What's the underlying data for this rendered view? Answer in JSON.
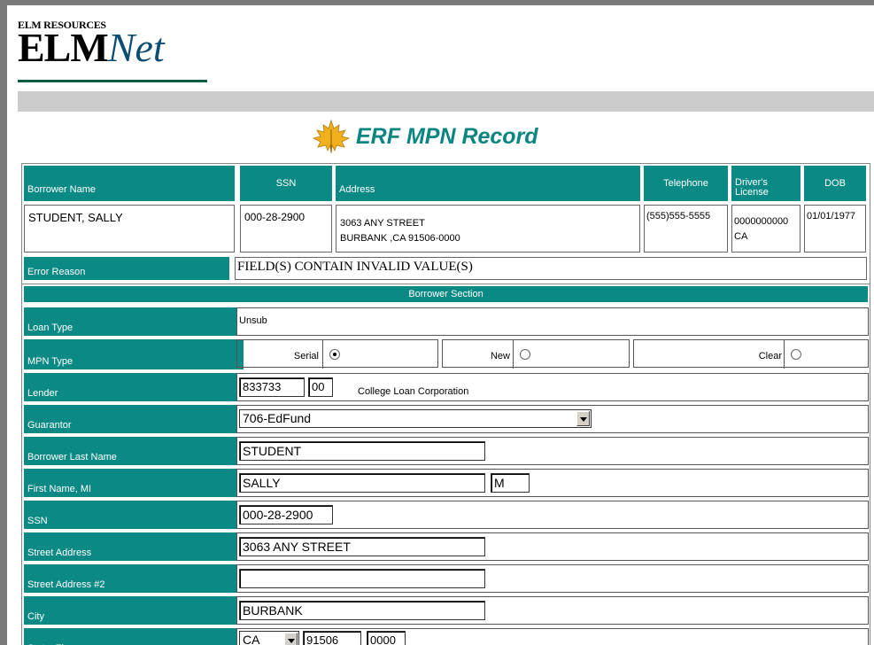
{
  "logo": {
    "top_text": "ELM RESOURCES",
    "elm": "ELM",
    "net": "Net"
  },
  "page_title": "ERF MPN Record",
  "borrower_table": {
    "headers": [
      "Borrower Name",
      "SSN",
      "Address",
      "Telephone",
      "Driver's License",
      "DOB"
    ],
    "row": {
      "name": "STUDENT, SALLY",
      "ssn": "000-28-2900",
      "address_line1": "3063 ANY STREET",
      "address_line2": "BURBANK ,CA 91506-0000",
      "telephone": "(555)555-5555",
      "license_number": "0000000000",
      "license_state": "CA",
      "dob": "01/01/1977"
    }
  },
  "error": {
    "label": "Error Reason",
    "value": "FIELD(S) CONTAIN INVALID VALUE(S)"
  },
  "borrower_section": {
    "title": "Borrower Section",
    "loan_type": {
      "label": "Loan Type",
      "value": "Unsub"
    },
    "mpn_type": {
      "label": "MPN Type",
      "options": [
        "Serial",
        "New",
        "Clear"
      ],
      "selected": "Serial"
    },
    "lender": {
      "label": "Lender",
      "code": "833733",
      "branch": "00",
      "name": "College Loan Corporation"
    },
    "guarantor": {
      "label": "Guarantor",
      "value": "706-EdFund"
    },
    "last_name": {
      "label": "Borrower Last Name",
      "value": "STUDENT"
    },
    "first_name": {
      "label": "First Name, MI",
      "value": "SALLY",
      "mi": "M"
    },
    "ssn": {
      "label": "SSN",
      "value": "000-28-2900"
    },
    "street": {
      "label": "Street Address",
      "value": "3063 ANY STREET"
    },
    "street2": {
      "label": "Street Address #2",
      "value": ""
    },
    "city": {
      "label": "City",
      "value": "BURBANK"
    },
    "state_zip": {
      "label": "State, Zip",
      "state": "CA",
      "zip": "91506",
      "zip4": "0000"
    }
  }
}
